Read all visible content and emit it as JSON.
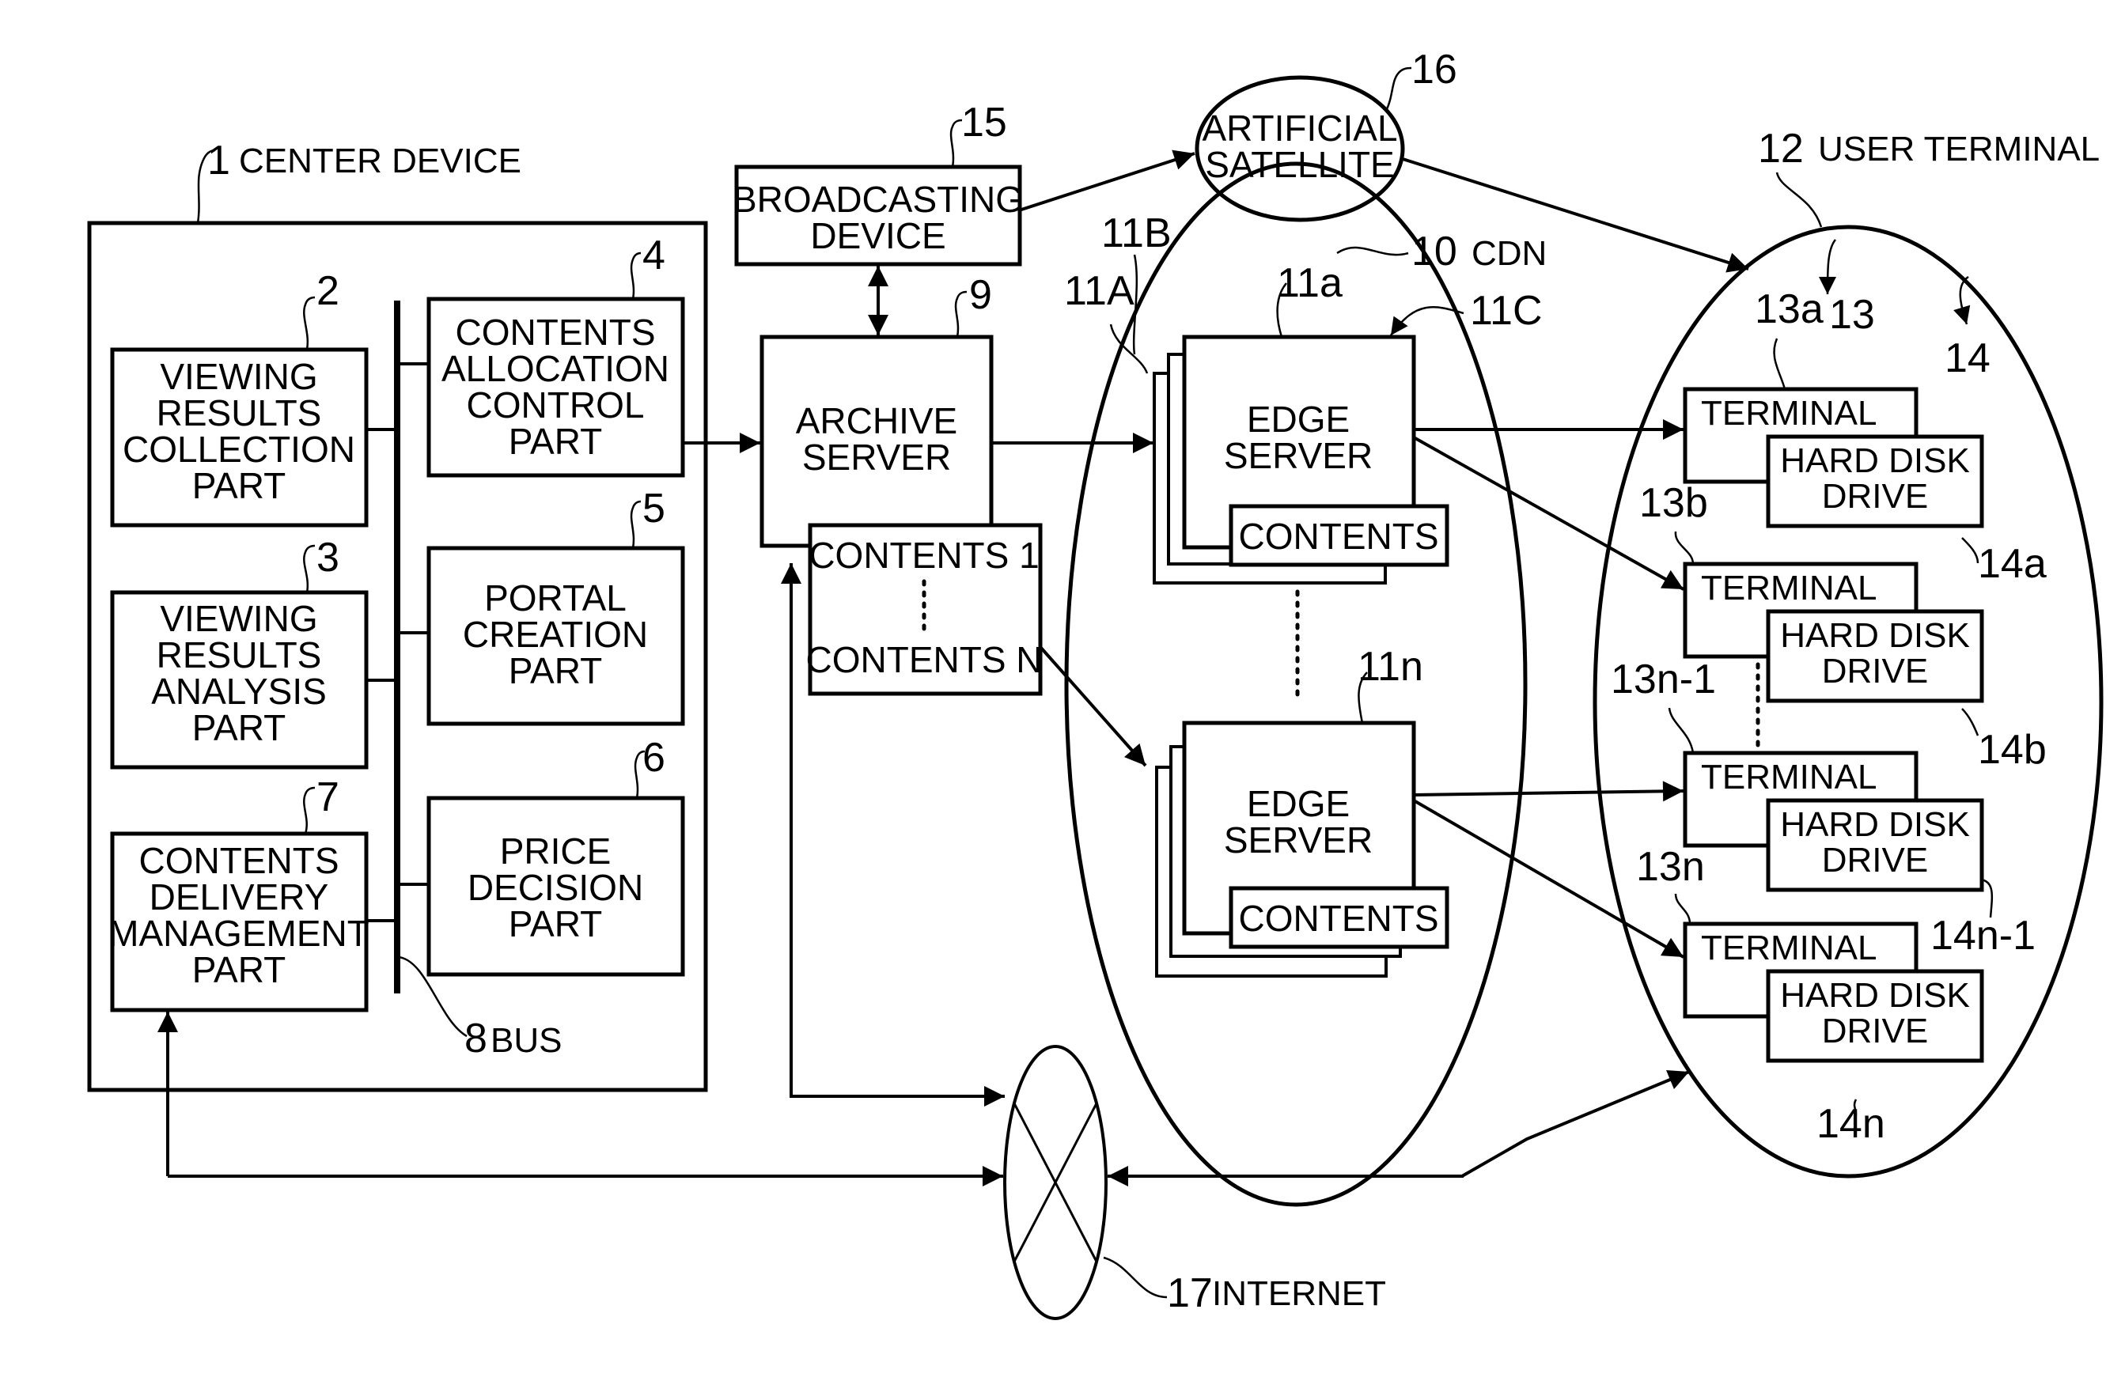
{
  "figure": {
    "center_device": {
      "ref": "1",
      "label": "CENTER DEVICE"
    },
    "viewing_results_collection": {
      "ref": "2",
      "lines": [
        "VIEWING",
        "RESULTS",
        "COLLECTION",
        "PART"
      ]
    },
    "viewing_results_analysis": {
      "ref": "3",
      "lines": [
        "VIEWING",
        "RESULTS",
        "ANALYSIS",
        "PART"
      ]
    },
    "contents_allocation_control": {
      "ref": "4",
      "lines": [
        "CONTENTS",
        "ALLOCATION",
        "CONTROL",
        "PART"
      ]
    },
    "portal_creation": {
      "ref": "5",
      "lines": [
        "PORTAL",
        "CREATION",
        "PART"
      ]
    },
    "price_decision": {
      "ref": "6",
      "lines": [
        "PRICE",
        "DECISION",
        "PART"
      ]
    },
    "contents_delivery_management": {
      "ref": "7",
      "lines": [
        "CONTENTS",
        "DELIVERY",
        "MANAGEMENT",
        "PART"
      ]
    },
    "bus": {
      "ref": "8",
      "label": "BUS"
    },
    "archive_server": {
      "ref": "9",
      "lines": [
        "ARCHIVE",
        "SERVER"
      ],
      "contents_first": "CONTENTS 1",
      "contents_last": "CONTENTS N"
    },
    "cdn": {
      "ref": "10",
      "label": "CDN"
    },
    "edge_servers": {
      "ref_11A": "11A",
      "ref_11B": "11B",
      "ref_11C": "11C",
      "ref_first": "11a",
      "ref_last": "11n",
      "lines": [
        "EDGE",
        "SERVER"
      ],
      "contents_label": "CONTENTS"
    },
    "user_terminal": {
      "ref": "12",
      "label": "USER TERMINAL"
    },
    "terminals": {
      "group_ref": "13",
      "hdd_group_ref": "14",
      "terminal_label": "TERMINAL",
      "hdd_lines": [
        "HARD DISK",
        "DRIVE"
      ],
      "items": [
        {
          "terminal_ref": "13a",
          "hdd_ref": "14a"
        },
        {
          "terminal_ref": "13b",
          "hdd_ref": "14b"
        },
        {
          "terminal_ref": "13n-1",
          "hdd_ref": "14n-1"
        },
        {
          "terminal_ref": "13n",
          "hdd_ref": "14n"
        }
      ]
    },
    "broadcasting_device": {
      "ref": "15",
      "lines": [
        "BROADCASTING",
        "DEVICE"
      ]
    },
    "artificial_satellite": {
      "ref": "16",
      "lines": [
        "ARTIFICIAL",
        "SATELLITE"
      ]
    },
    "internet": {
      "ref": "17",
      "label": "INTERNET"
    }
  }
}
